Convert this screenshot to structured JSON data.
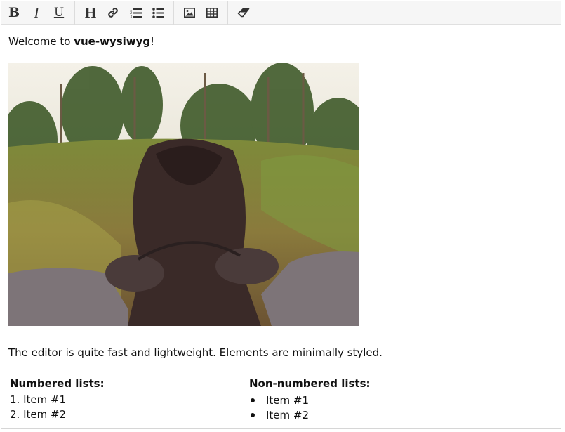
{
  "toolbar": {
    "buttons": [
      {
        "name": "bold",
        "glyph": "B"
      },
      {
        "name": "italic",
        "glyph": "I"
      },
      {
        "name": "underline",
        "glyph": "U"
      },
      {
        "name": "heading",
        "glyph": "H"
      },
      {
        "name": "link"
      },
      {
        "name": "ordered-list"
      },
      {
        "name": "unordered-list"
      },
      {
        "name": "image"
      },
      {
        "name": "table"
      },
      {
        "name": "remove-format"
      }
    ]
  },
  "content": {
    "welcome_prefix": "Welcome to ",
    "welcome_strong": "vue-wysiwyg",
    "welcome_suffix": "!",
    "description": "The editor is quite fast and lightweight. Elements are minimally styled.",
    "numbered": {
      "title": "Numbered lists:",
      "items": [
        "1. Item #1",
        "2. Item #2"
      ]
    },
    "bulleted": {
      "title": "Non-numbered lists:",
      "items": [
        "Item #1",
        "Item #2"
      ]
    }
  }
}
